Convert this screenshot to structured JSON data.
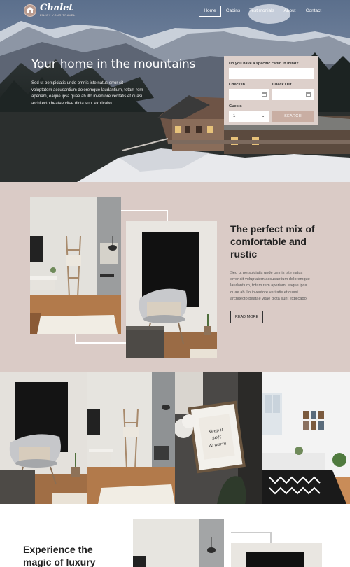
{
  "brand": {
    "name": "Chalet",
    "tagline": "ENJOY YOUR TRAVEL"
  },
  "nav": {
    "items": [
      "Home",
      "Cabins",
      "Testimonials",
      "About",
      "Contact"
    ],
    "active": "Home"
  },
  "hero": {
    "title": "Your home in the mountains",
    "text": "Sed ut perspiciatis unde omnis iste natus error sit voluptatem accusantium doloremque laudantium, totam rem aperiam, eaque ipsa quae ab illo inventore veritatis et quasi architecto beatae vitae dicta sunt explicabo."
  },
  "booking_form": {
    "cabin_label": "Do you have a specific cabin in mind?",
    "cabin_value": "",
    "checkin_label": "Check In",
    "checkout_label": "Check Out",
    "guests_label": "Guests",
    "guests_value": "1",
    "search_label": "SEARCH"
  },
  "about": {
    "title": "The perfect mix of comfortable and rustic",
    "text": "Sed ut perspiciatis unde omnis iste natus error sit voluptatem accusantium doloremque laudantium, totam rem aperiam, eaque ipsa quae ab illo inventore veritatis et quasi architecto beatae vitae dicta sunt explicabo.",
    "button_label": "READ MORE"
  },
  "gallery": {
    "framed_print_text": "Keep it soft & warm"
  },
  "luxury": {
    "title": "Experience the magic of luxury"
  },
  "colors": {
    "accent": "#c9aea3",
    "section_bg": "#dacbc6",
    "form_bg": "#ddd0cb"
  }
}
